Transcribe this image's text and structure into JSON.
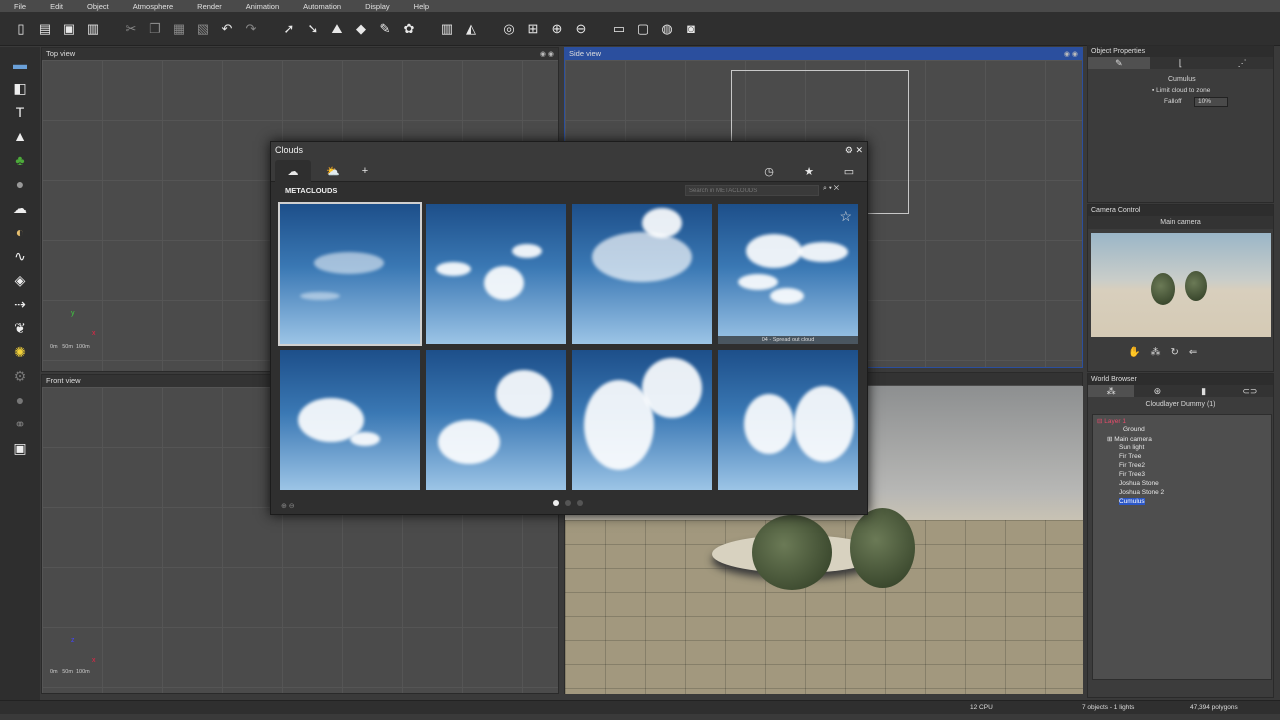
{
  "menu": [
    "File",
    "Edit",
    "Object",
    "Atmosphere",
    "Render",
    "Animation",
    "Automation",
    "Display",
    "Help"
  ],
  "viewports": {
    "top": "Top view",
    "side": "Side view",
    "front": "Front view",
    "scale_labels": [
      "0m",
      "50m",
      "100m"
    ]
  },
  "dialog": {
    "title": "Clouds",
    "section": "METACLOUDS",
    "search_placeholder": "Search in METACLOUDS",
    "hover_label": "04 - Spread out cloud",
    "add": "+"
  },
  "object_properties": {
    "title": "Object Properties",
    "name": "Cumulus",
    "limit_label": "Limit cloud to zone",
    "falloff_label": "Falloff",
    "falloff_value": "10%"
  },
  "camera_control": {
    "title": "Camera Control",
    "camera": "Main camera"
  },
  "world_browser": {
    "title": "World Browser",
    "header": "Cloudlayer Dummy (1)",
    "items": [
      "Layer 1",
      "Ground",
      "Main camera",
      "Sun light",
      "Fir Tree",
      "Fir Tree2",
      "Fir Tree3",
      "Joshua Stone",
      "Joshua Stone 2",
      "Cumulus"
    ]
  },
  "status": {
    "cpu": "12 CPU",
    "objects": "7 objects - 1 lights",
    "polygons": "47,394 polygons"
  }
}
